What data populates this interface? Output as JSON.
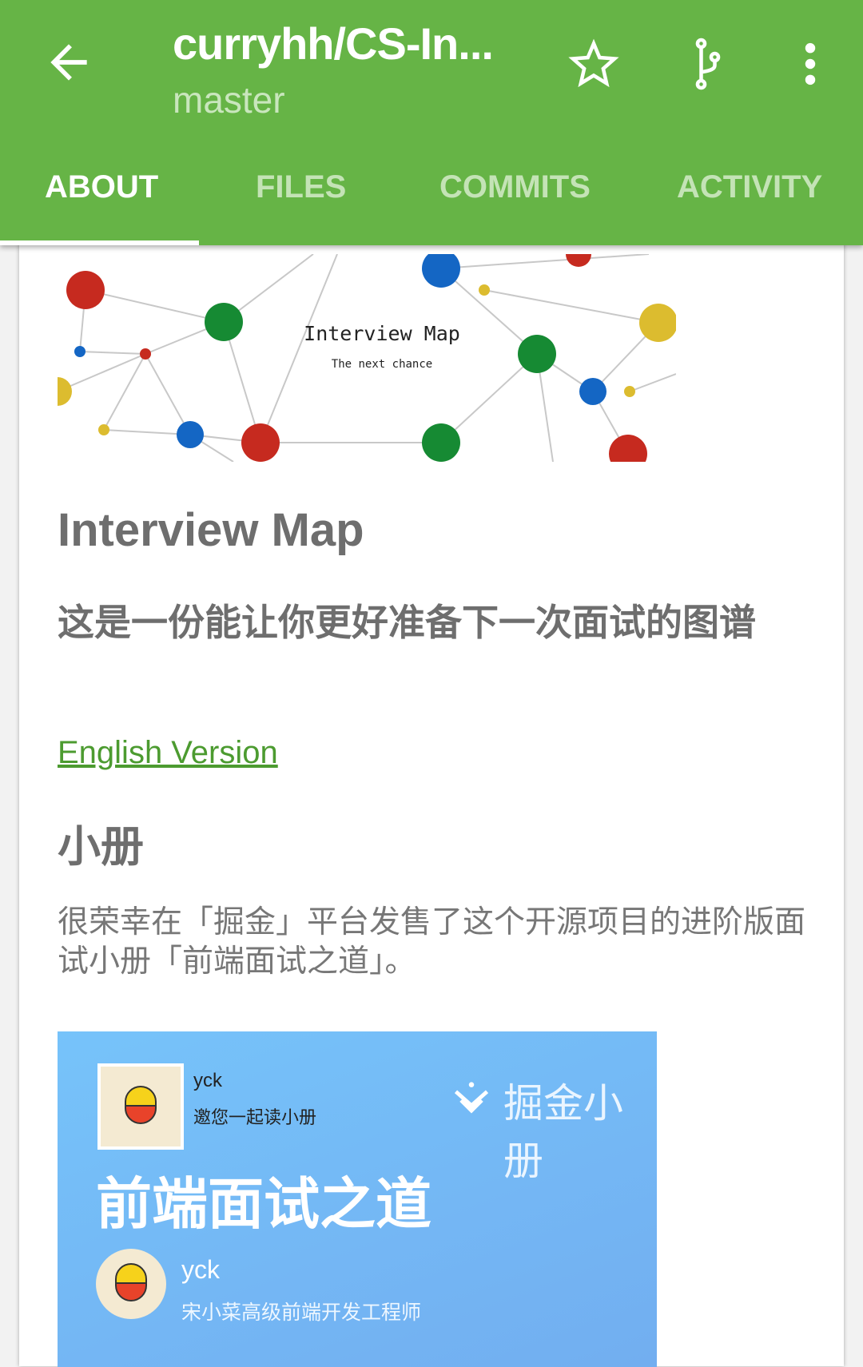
{
  "appbar": {
    "title": "curryhh/CS-In...",
    "subtitle": "master",
    "icons": [
      "arrow-back-icon",
      "star-icon",
      "fork-icon",
      "more-vert-icon"
    ]
  },
  "tabs": [
    {
      "label": "ABOUT",
      "active": true
    },
    {
      "label": "FILES"
    },
    {
      "label": "COMMITS"
    },
    {
      "label": "ACTIVITY"
    }
  ],
  "colors": {
    "primary": "#66b446",
    "link": "#4c9b30",
    "text": "#6e6e6e"
  },
  "readme": {
    "banner": {
      "title": "Interview Map",
      "subtitle": "The next chance"
    },
    "h1": "Interview Map",
    "h2": "这是一份能让你更好准备下一次面试的图谱",
    "link": "English Version",
    "h3": "小册",
    "paragraph": "很荣幸在「掘金」平台发售了这个开源项目的进阶版面试小册「前端面试之道」。",
    "promo": {
      "user": "yck",
      "invite": "邀您一起读小册",
      "brand": "掘金小册",
      "book_title": "前端面试之道",
      "author": "yck",
      "author_title": "宋小菜高级前端开发工程师"
    }
  }
}
